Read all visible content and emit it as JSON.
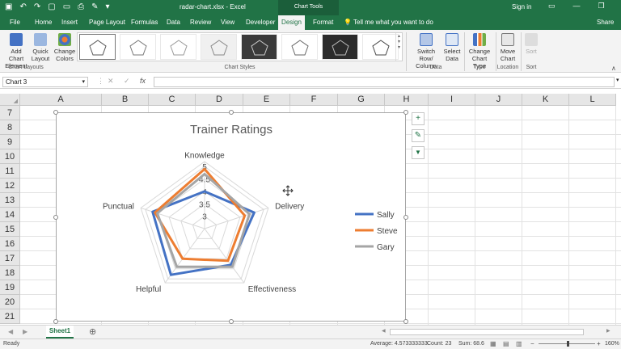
{
  "titlebar": {
    "filename": "radar-chart.xlsx - Excel",
    "context": "Chart Tools",
    "signin": "Sign in"
  },
  "tabs": [
    "File",
    "Home",
    "Insert",
    "Page Layout",
    "Formulas",
    "Data",
    "Review",
    "View",
    "Developer"
  ],
  "active_tab": "Design",
  "format_tab": "Format",
  "tell_me": "Tell me what you want to do",
  "share": "Share",
  "ribbon": {
    "add_chart_element": "Add Chart Element",
    "quick_layout": "Quick Layout",
    "change_colors": "Change Colors",
    "chart_layouts": "Chart Layouts",
    "chart_styles": "Chart Styles",
    "switch_row_column": "Switch Row/ Column",
    "select_data": "Select Data",
    "data_group": "Data",
    "change_chart_type": "Change Chart Type",
    "type_group": "Type",
    "move_chart": "Move Chart",
    "location_group": "Location",
    "sort": "Sort",
    "sort_group": "Sort"
  },
  "namebox": "Chart 3",
  "fx": "fx",
  "columns": [
    "A",
    "B",
    "C",
    "D",
    "E",
    "F",
    "G",
    "H",
    "I",
    "J",
    "K",
    "L"
  ],
  "rows": [
    "7",
    "8",
    "9",
    "10",
    "11",
    "12",
    "13",
    "14",
    "15",
    "16",
    "17",
    "18",
    "19",
    "20",
    "21"
  ],
  "sheet_tab": "Sheet1",
  "status": {
    "ready": "Ready",
    "average": "Average: 4.573333333",
    "count": "Count: 23",
    "sum": "Sum: 68.6",
    "zoom": "160%"
  },
  "chart_data": {
    "type": "radar",
    "title": "Trainer Ratings",
    "categories": [
      "Knowledge",
      "Delivery",
      "Effectiveness",
      "Helpful",
      "Punctual"
    ],
    "ticks": [
      "3",
      "3.5",
      "4",
      "4.5",
      "5"
    ],
    "rmin": 2.5,
    "rmax": 5.2,
    "legend": "right",
    "series": [
      {
        "name": "Sally",
        "color": "#4472c4",
        "values": [
          4.0,
          4.6,
          4.3,
          4.8,
          4.7
        ]
      },
      {
        "name": "Steve",
        "color": "#ed7d31",
        "values": [
          4.9,
          4.2,
          4.1,
          4.0,
          4.6
        ]
      },
      {
        "name": "Gary",
        "color": "#a5a5a5",
        "values": [
          4.7,
          4.4,
          4.4,
          4.4,
          4.5
        ]
      }
    ]
  }
}
